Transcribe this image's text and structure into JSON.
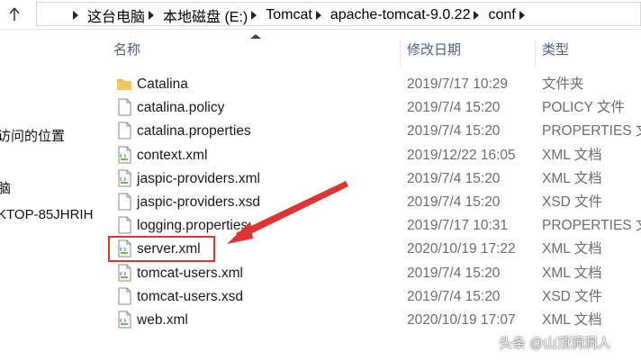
{
  "address_bar": {
    "breadcrumbs": [
      "这台电脑",
      "本地磁盘 (E:)",
      "Tomcat",
      "apache-tomcat-9.0.22",
      "conf"
    ]
  },
  "nav_pane": {
    "items": [
      "访问的位置",
      "脑",
      "KTOP-85JHRIH"
    ]
  },
  "columns": {
    "name": "名称",
    "date_modified": "修改日期",
    "type": "类型"
  },
  "files": [
    {
      "name": "Catalina",
      "date": "2019/7/17 10:29",
      "type": "文件夹",
      "icon": "folder-icon"
    },
    {
      "name": "catalina.policy",
      "date": "2019/7/4 15:20",
      "type": "POLICY 文件",
      "icon": "file-icon"
    },
    {
      "name": "catalina.properties",
      "date": "2019/7/4 15:20",
      "type": "PROPERTIES 文件",
      "icon": "file-icon"
    },
    {
      "name": "context.xml",
      "date": "2019/12/22 16:05",
      "type": "XML 文档",
      "icon": "xml-file-icon"
    },
    {
      "name": "jaspic-providers.xml",
      "date": "2019/7/4 15:20",
      "type": "XML 文档",
      "icon": "xml-file-icon"
    },
    {
      "name": "jaspic-providers.xsd",
      "date": "2019/7/4 15:20",
      "type": "XSD 文件",
      "icon": "file-icon"
    },
    {
      "name": "logging.properties",
      "date": "2019/7/17 10:31",
      "type": "PROPERTIES 文件",
      "icon": "file-icon"
    },
    {
      "name": "server.xml",
      "date": "2020/10/19 17:22",
      "type": "XML 文档",
      "icon": "xml-file-icon"
    },
    {
      "name": "tomcat-users.xml",
      "date": "2019/7/4 15:20",
      "type": "XML 文档",
      "icon": "xml-file-icon"
    },
    {
      "name": "tomcat-users.xsd",
      "date": "2019/7/4 15:20",
      "type": "XSD 文件",
      "icon": "file-icon"
    },
    {
      "name": "web.xml",
      "date": "2020/10/19 17:07",
      "type": "XML 文档",
      "icon": "xml-file-icon"
    }
  ],
  "annotation": {
    "highlighted_file": "server.xml",
    "color": "#e03434"
  },
  "watermark": "头条 @山顶洞洞人"
}
